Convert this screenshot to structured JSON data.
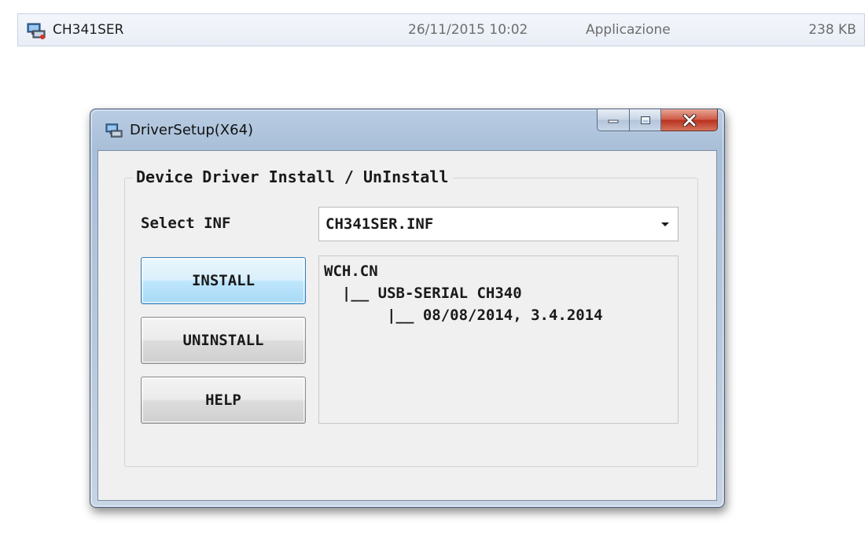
{
  "file_row": {
    "icon": "driver-setup-icon",
    "name": "CH341SER",
    "date": "26/11/2015 10:02",
    "type": "Applicazione",
    "size": "238 KB"
  },
  "window": {
    "title": "DriverSetup(X64)",
    "icon": "driver-setup-icon",
    "buttons": {
      "minimize": "minimize-icon",
      "maximize": "maximize-icon",
      "close": "close-icon"
    },
    "group_title": "Device Driver Install / UnInstall",
    "select_label": "Select INF",
    "select_value": "CH341SER.INF",
    "install_label": "INSTALL",
    "uninstall_label": "UNINSTALL",
    "help_label": "HELP",
    "info_lines": [
      "WCH.CN",
      "  |__ USB-SERIAL CH340",
      "       |__ 08/08/2014, 3.4.2014"
    ]
  },
  "colors": {
    "install_button_accent": "#bee6fd",
    "close_button": "#c7442e",
    "window_frame": "#b0c4dc"
  }
}
